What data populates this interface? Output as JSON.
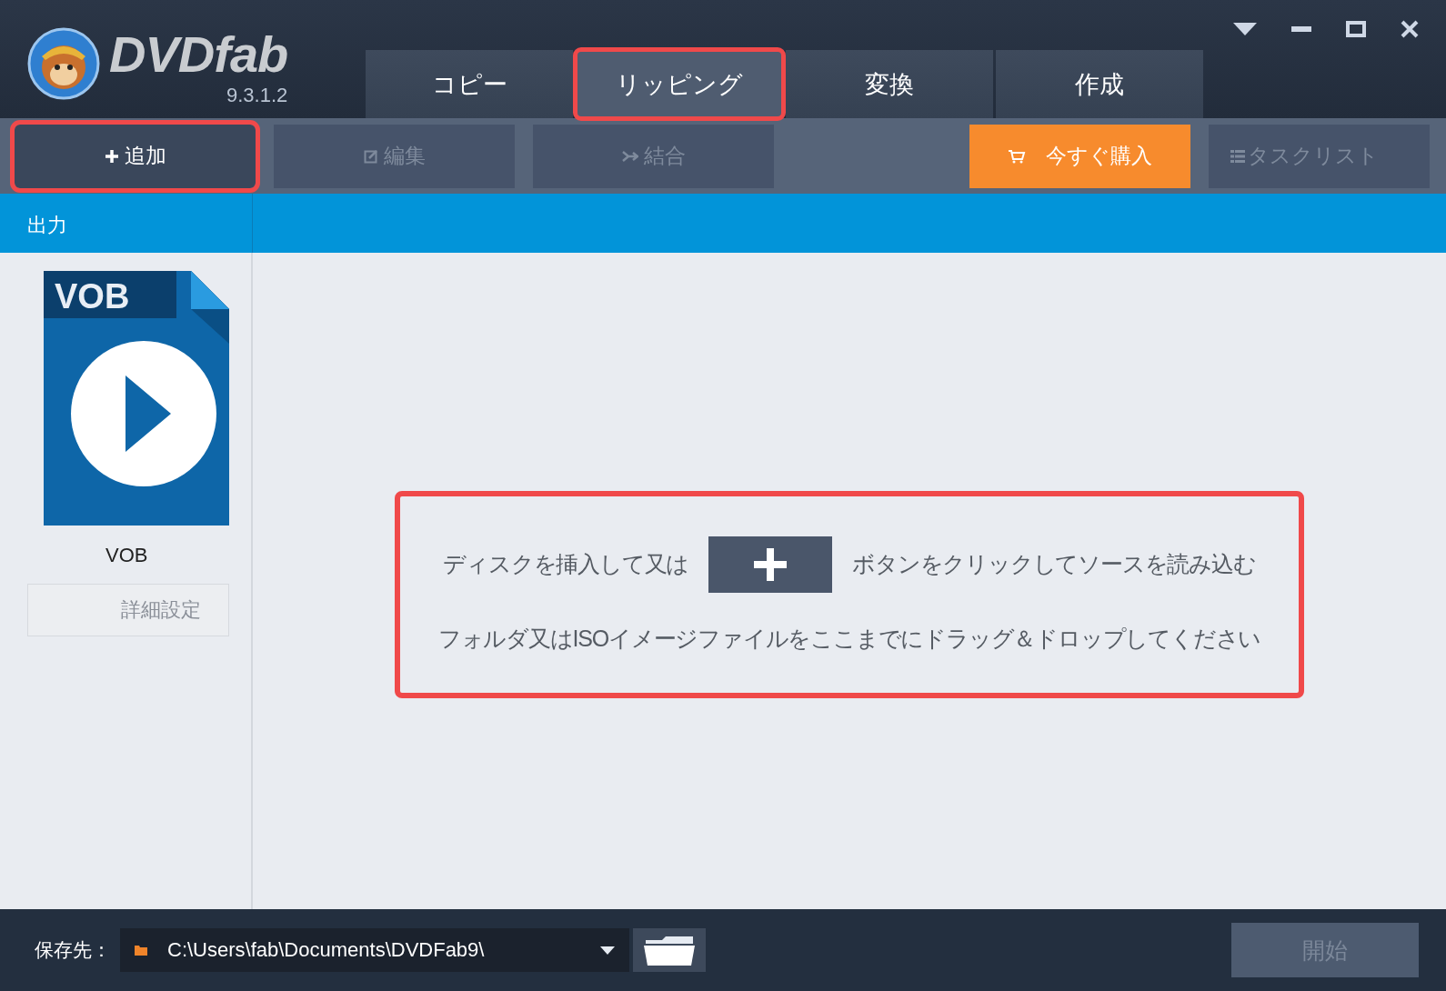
{
  "app": {
    "logo": "DVDfab",
    "version": "9.3.1.2"
  },
  "tabs": [
    {
      "label": "コピー",
      "selected": false,
      "highlighted": false
    },
    {
      "label": "リッピング",
      "selected": true,
      "highlighted": true
    },
    {
      "label": "変換",
      "selected": false,
      "highlighted": false
    },
    {
      "label": "作成",
      "selected": false,
      "highlighted": false
    }
  ],
  "toolbar": [
    {
      "kind": "add",
      "label": "追加",
      "disabled": false,
      "highlighted": true
    },
    {
      "kind": "edit",
      "label": "編集",
      "disabled": true,
      "highlighted": false
    },
    {
      "kind": "merge",
      "label": "結合",
      "disabled": true,
      "highlighted": false
    },
    {
      "kind": "buy",
      "label": "今すぐ購入",
      "disabled": false,
      "highlighted": false
    },
    {
      "kind": "tasklist",
      "label": "タスクリスト",
      "disabled": true,
      "highlighted": false
    }
  ],
  "output_bar": {
    "label": "出力"
  },
  "profile": {
    "badge": "VOB",
    "name": "VOB",
    "settings_button": "詳細設定"
  },
  "drop_zone": {
    "highlighted": true,
    "line1_before": "ディスクを挿入して又は",
    "line1_after": "ボタンをクリックしてソースを読み込む",
    "line2": "フォルダ又はISOイメージファイルをここまでにドラッグ＆ドロップしてください"
  },
  "footer": {
    "label": "保存先：",
    "path": "C:\\Users\\fab\\Documents\\DVDFab9\\",
    "start_button": "開始",
    "start_disabled": true
  }
}
